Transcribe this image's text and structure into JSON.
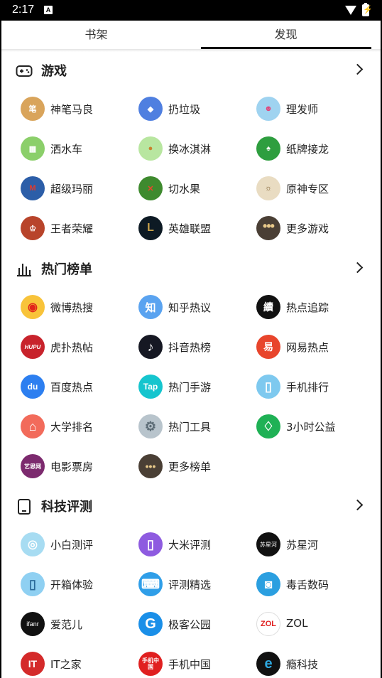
{
  "status_bar": {
    "time": "2:17",
    "notification_icon": "A",
    "battery_icon": "battery-charging-icon"
  },
  "tabs": [
    {
      "label": "书架"
    },
    {
      "label": "发现"
    }
  ],
  "sections": [
    {
      "title": "游戏",
      "icon": "gamepad-icon",
      "items": [
        {
          "label": "神笔马良",
          "icon": "shenbi-maliang-icon",
          "color": "#d9a45b"
        },
        {
          "label": "扔垃圾",
          "icon": "trash-throw-icon",
          "color": "#4f7fe0"
        },
        {
          "label": "理发师",
          "icon": "barber-icon",
          "color": "#9fd3f0"
        },
        {
          "label": "洒水车",
          "icon": "sprinkler-truck-icon",
          "color": "#8bcf6a"
        },
        {
          "label": "换冰淇淋",
          "icon": "ice-cream-icon",
          "color": "#b8e6a0"
        },
        {
          "label": "纸牌接龙",
          "icon": "solitaire-cards-icon",
          "color": "#2e9e3f"
        },
        {
          "label": "超级玛丽",
          "icon": "super-mario-icon",
          "color": "#2c5ea8"
        },
        {
          "label": "切水果",
          "icon": "fruit-ninja-icon",
          "color": "#3e8a2e"
        },
        {
          "label": "原神专区",
          "icon": "genshin-icon",
          "color": "#e9dcc2"
        },
        {
          "label": "王者荣耀",
          "icon": "honor-of-kings-icon",
          "color": "#b8442b"
        },
        {
          "label": "英雄联盟",
          "icon": "league-of-legends-icon",
          "color": "#0d1a24"
        },
        {
          "label": "更多游戏",
          "icon": "more-dots-icon",
          "color": "#4a3f35"
        }
      ]
    },
    {
      "title": "热门榜单",
      "icon": "bar-chart-icon",
      "items": [
        {
          "label": "微博热搜",
          "icon": "weibo-icon",
          "color": "#f8c33a",
          "glyph": "◉"
        },
        {
          "label": "知乎热议",
          "icon": "zhihu-icon",
          "color": "#5aa3f0",
          "glyph": "知"
        },
        {
          "label": "热点追踪",
          "icon": "hot-tracking-icon",
          "color": "#111111",
          "glyph": "續"
        },
        {
          "label": "虎扑热帖",
          "icon": "hupu-icon",
          "color": "#c8232c",
          "glyph": "HUPU"
        },
        {
          "label": "抖音热榜",
          "icon": "douyin-icon",
          "color": "#161823",
          "glyph": "♪"
        },
        {
          "label": "网易热点",
          "icon": "netease-icon",
          "color": "#e8452c",
          "glyph": "易"
        },
        {
          "label": "百度热点",
          "icon": "baidu-icon",
          "color": "#2d7ff0",
          "glyph": "du"
        },
        {
          "label": "热门手游",
          "icon": "taptap-icon",
          "color": "#15c5ce",
          "glyph": "Tap"
        },
        {
          "label": "手机排行",
          "icon": "phone-ranking-icon",
          "color": "#7ec9ef",
          "glyph": "▯"
        },
        {
          "label": "大学排名",
          "icon": "university-icon",
          "color": "#f26b5b",
          "glyph": "⌂"
        },
        {
          "label": "热门工具",
          "icon": "tools-gear-icon",
          "color": "#b8c4cc",
          "glyph": "⚙"
        },
        {
          "label": "3小时公益",
          "icon": "charity-icon",
          "color": "#1fb155",
          "glyph": "♢"
        },
        {
          "label": "电影票房",
          "icon": "box-office-icon",
          "color": "#7c2a6e",
          "glyph": "艺恩网"
        },
        {
          "label": "更多榜单",
          "icon": "more-dots-icon",
          "color": "#4a3f35",
          "glyph": "•••"
        }
      ]
    },
    {
      "title": "科技评测",
      "icon": "tablet-icon",
      "items": [
        {
          "label": "小白测评",
          "icon": "xiaobai-icon",
          "color": "#a7dcf2",
          "glyph": "◎"
        },
        {
          "label": "大米评测",
          "icon": "dami-icon",
          "color": "#8e5be0",
          "glyph": "▯"
        },
        {
          "label": "苏星河",
          "icon": "suxinghe-icon",
          "color": "#111111",
          "glyph": "苏星河"
        },
        {
          "label": "开箱体验",
          "icon": "unboxing-icon",
          "color": "#8fd0f2",
          "glyph": "▯"
        },
        {
          "label": "评测精选",
          "icon": "review-picks-icon",
          "color": "#2f9ee8",
          "glyph": "⌨"
        },
        {
          "label": "毒舌数码",
          "icon": "camera-icon",
          "color": "#2b9fe0",
          "glyph": "◙"
        },
        {
          "label": "爱范儿",
          "icon": "ifanr-icon",
          "color": "#111111",
          "glyph": "ifanr"
        },
        {
          "label": "极客公园",
          "icon": "geekpark-icon",
          "color": "#1a8fe8",
          "glyph": "G"
        },
        {
          "label": "ZOL",
          "icon": "zol-icon",
          "color": "#ffffff",
          "glyph": "ZOL"
        },
        {
          "label": "IT之家",
          "icon": "ithome-icon",
          "color": "#d42a2a",
          "glyph": "IT"
        },
        {
          "label": "手机中国",
          "icon": "cnmo-icon",
          "color": "#e02020",
          "glyph": "手机中国"
        },
        {
          "label": "瘾科技",
          "icon": "engadget-icon",
          "color": "#111111",
          "glyph": "e"
        }
      ]
    }
  ]
}
